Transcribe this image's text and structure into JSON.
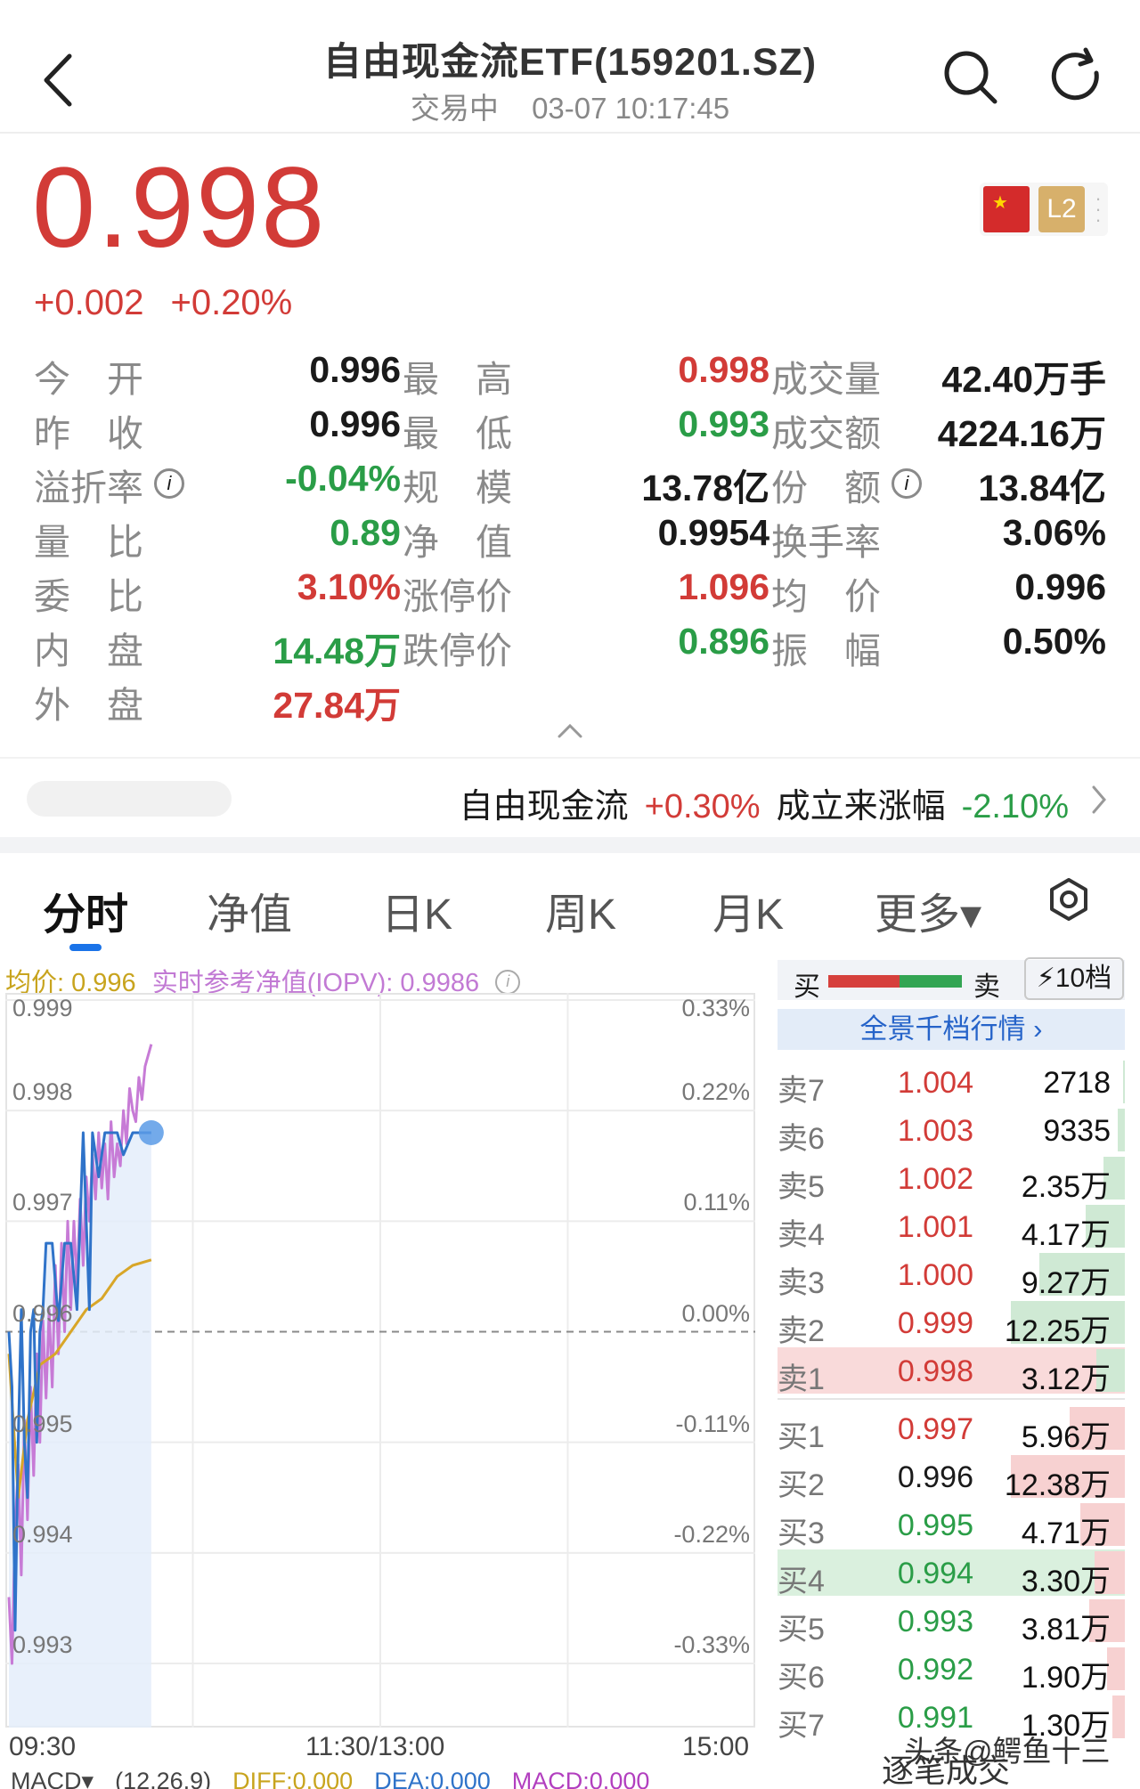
{
  "header": {
    "title": "自由现金流ETF(159201.SZ)",
    "status": "交易中",
    "datetime": "03-07 10:17:45"
  },
  "quote": {
    "price": "0.998",
    "change": "+0.002",
    "change_pct": "+0.20%",
    "badge_l2": "L2"
  },
  "stats": {
    "rows": [
      [
        {
          "label": "今　开",
          "value": "0.996",
          "color": "dark"
        },
        {
          "label": "最　高",
          "value": "0.998",
          "color": "up"
        },
        {
          "label": "成交量",
          "value": "42.40万手",
          "color": "dark"
        }
      ],
      [
        {
          "label": "昨　收",
          "value": "0.996",
          "color": "dark"
        },
        {
          "label": "最　低",
          "value": "0.993",
          "color": "down"
        },
        {
          "label": "成交额",
          "value": "4224.16万",
          "color": "dark"
        }
      ],
      [
        {
          "label": "溢折率",
          "value": "-0.04%",
          "color": "down"
        },
        {
          "label": "规　模",
          "value": "13.78亿",
          "color": "dark"
        },
        {
          "label": "份　额",
          "value": "13.84亿",
          "color": "dark"
        }
      ],
      [
        {
          "label": "量　比",
          "value": "0.89",
          "color": "down"
        },
        {
          "label": "净　值",
          "value": "0.9954",
          "color": "dark"
        },
        {
          "label": "换手率",
          "value": "3.06%",
          "color": "dark"
        }
      ],
      [
        {
          "label": "委　比",
          "value": "3.10%",
          "color": "up"
        },
        {
          "label": "涨停价",
          "value": "1.096",
          "color": "up"
        },
        {
          "label": "均　价",
          "value": "0.996",
          "color": "dark"
        }
      ],
      [
        {
          "label": "内　盘",
          "value": "14.48万",
          "color": "down"
        },
        {
          "label": "跌停价",
          "value": "0.896",
          "color": "down"
        },
        {
          "label": "振　幅",
          "value": "0.50%",
          "color": "dark"
        }
      ],
      [
        {
          "label": "外　盘",
          "value": "27.84万",
          "color": "up"
        }
      ]
    ]
  },
  "index_bar": {
    "index_name": "自由现金流",
    "index_change": "+0.30%",
    "since_label": "成立来涨幅",
    "since_value": "-2.10%"
  },
  "tabs": [
    "分时",
    "净值",
    "日K",
    "周K",
    "月K",
    "更多▾"
  ],
  "chart_legend": {
    "avg": "均价: 0.996",
    "iopv": "实时参考净值(IOPV): 0.9986"
  },
  "chart_data": {
    "type": "line",
    "y_left_ticks": [
      "0.999",
      "0.998",
      "0.997",
      "0.996",
      "0.995",
      "0.994",
      "0.993"
    ],
    "y_right_ticks": [
      "0.33%",
      "0.22%",
      "0.11%",
      "0.00%",
      "-0.11%",
      "-0.22%",
      "-0.33%"
    ],
    "x_ticks": [
      "09:30",
      "11:30/13:00",
      "15:00"
    ],
    "ylim": [
      0.993,
      0.999
    ],
    "prev_close": 0.996,
    "x_total_minutes": 240,
    "series": [
      {
        "color": "#2f73c9",
        "points": [
          [
            0,
            0.996
          ],
          [
            1,
            0.9955
          ],
          [
            2,
            0.9933
          ],
          [
            3,
            0.995
          ],
          [
            4,
            0.9962
          ],
          [
            5,
            0.995
          ],
          [
            6,
            0.9945
          ],
          [
            7,
            0.996
          ],
          [
            8,
            0.9962
          ],
          [
            9,
            0.995
          ],
          [
            10,
            0.996
          ],
          [
            11,
            0.9962
          ],
          [
            12,
            0.9968
          ],
          [
            14,
            0.9968
          ],
          [
            16,
            0.9961
          ],
          [
            18,
            0.9968
          ],
          [
            20,
            0.9968
          ],
          [
            22,
            0.9962
          ],
          [
            24,
            0.9978
          ],
          [
            26,
            0.9962
          ],
          [
            27,
            0.9978
          ],
          [
            29,
            0.9974
          ],
          [
            31,
            0.9978
          ],
          [
            33,
            0.9978
          ],
          [
            35,
            0.9978
          ],
          [
            37,
            0.9976
          ],
          [
            40,
            0.9978
          ],
          [
            43,
            0.9978
          ],
          [
            46,
            0.9978
          ]
        ]
      },
      {
        "color": "#d8a628",
        "points": [
          [
            0,
            0.9958
          ],
          [
            3,
            0.9945
          ],
          [
            6,
            0.9952
          ],
          [
            10,
            0.9957
          ],
          [
            15,
            0.9958
          ],
          [
            20,
            0.996
          ],
          [
            25,
            0.9962
          ],
          [
            30,
            0.9963
          ],
          [
            35,
            0.9965
          ],
          [
            40,
            0.9966
          ],
          [
            46,
            0.99665
          ]
        ]
      },
      {
        "color": "#c77bd6",
        "points": [
          [
            0,
            0.9936
          ],
          [
            1,
            0.993
          ],
          [
            2,
            0.9942
          ],
          [
            3,
            0.9948
          ],
          [
            4,
            0.9938
          ],
          [
            5,
            0.9952
          ],
          [
            6,
            0.9943
          ],
          [
            7,
            0.9955
          ],
          [
            8,
            0.9947
          ],
          [
            9,
            0.9958
          ],
          [
            10,
            0.995
          ],
          [
            11,
            0.9961
          ],
          [
            12,
            0.9954
          ],
          [
            13,
            0.9962
          ],
          [
            14,
            0.9955
          ],
          [
            15,
            0.9966
          ],
          [
            16,
            0.9958
          ],
          [
            17,
            0.9968
          ],
          [
            18,
            0.996
          ],
          [
            19,
            0.997
          ],
          [
            20,
            0.9962
          ],
          [
            21,
            0.997
          ],
          [
            22,
            0.9964
          ],
          [
            23,
            0.9972
          ],
          [
            24,
            0.9966
          ],
          [
            25,
            0.9974
          ],
          [
            26,
            0.997
          ],
          [
            27,
            0.9976
          ],
          [
            28,
            0.9972
          ],
          [
            29,
            0.9978
          ],
          [
            30,
            0.9973
          ],
          [
            31,
            0.9977
          ],
          [
            32,
            0.9972
          ],
          [
            33,
            0.9979
          ],
          [
            34,
            0.9974
          ],
          [
            35,
            0.9977
          ],
          [
            36,
            0.9975
          ],
          [
            37,
            0.998
          ],
          [
            38,
            0.9977
          ],
          [
            39,
            0.9982
          ],
          [
            40,
            0.998
          ],
          [
            41,
            0.9979
          ],
          [
            42,
            0.9983
          ],
          [
            43,
            0.9981
          ],
          [
            44,
            0.9984
          ],
          [
            46,
            0.9986
          ]
        ]
      }
    ],
    "current_point": [
      46,
      0.9978
    ]
  },
  "macd": {
    "label": "MACD▾",
    "params": "(12,26,9)",
    "diff": "DIFF:0.000",
    "dea": "DEA:0.000",
    "macd": "MACD:0.000"
  },
  "orderbook": {
    "buy_label": "买",
    "sell_label": "卖",
    "levels_button": "10档",
    "full_depth": "全景千档行情 ›",
    "sell": [
      {
        "k": "卖7",
        "p": "1.004",
        "q": "2718",
        "dir": "up",
        "bar": 0.01
      },
      {
        "k": "卖6",
        "p": "1.003",
        "q": "9335",
        "dir": "up",
        "bar": 0.04
      },
      {
        "k": "卖5",
        "p": "1.002",
        "q": "2.35万",
        "dir": "up",
        "bar": 0.12
      },
      {
        "k": "卖4",
        "p": "1.001",
        "q": "4.17万",
        "dir": "up",
        "bar": 0.22
      },
      {
        "k": "卖3",
        "p": "1.000",
        "q": "9.27万",
        "dir": "up",
        "bar": 0.48
      },
      {
        "k": "卖2",
        "p": "0.999",
        "q": "12.25万",
        "dir": "up",
        "bar": 0.64
      },
      {
        "k": "卖1",
        "p": "0.998",
        "q": "3.12万",
        "dir": "up",
        "bar": 0.16,
        "hl": "sell"
      }
    ],
    "buy": [
      {
        "k": "买1",
        "p": "0.997",
        "q": "5.96万",
        "dir": "up",
        "bar": 0.31
      },
      {
        "k": "买2",
        "p": "0.996",
        "q": "12.38万",
        "dir": "dark",
        "bar": 0.64
      },
      {
        "k": "买3",
        "p": "0.995",
        "q": "4.71万",
        "dir": "down",
        "bar": 0.25
      },
      {
        "k": "买4",
        "p": "0.994",
        "q": "3.30万",
        "dir": "down",
        "bar": 0.17,
        "hl": "buy"
      },
      {
        "k": "买5",
        "p": "0.993",
        "q": "3.81万",
        "dir": "down",
        "bar": 0.2
      },
      {
        "k": "买6",
        "p": "0.992",
        "q": "1.90万",
        "dir": "down",
        "bar": 0.1
      },
      {
        "k": "买7",
        "p": "0.991",
        "q": "1.30万",
        "dir": "down",
        "bar": 0.07
      }
    ],
    "footer": "逐笔成交"
  },
  "watermark": "头条@鳄鱼十三",
  "colors": {
    "up": "#d23b37",
    "down": "#2a9d47",
    "accent": "#1a73e8"
  }
}
